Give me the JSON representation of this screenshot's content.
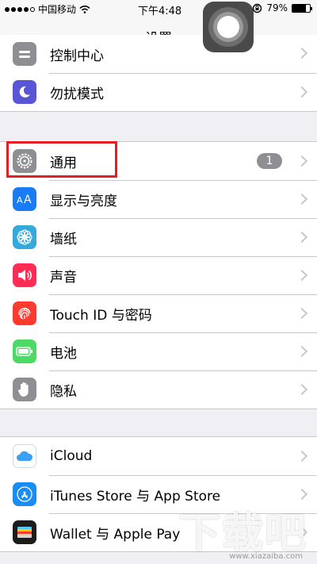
{
  "status_bar": {
    "carrier": "中国移动",
    "time": "下午4:48",
    "battery_text": "79%",
    "battery_level": 0.79
  },
  "nav": {
    "title": "设置"
  },
  "groups": {
    "top": [
      {
        "label": "控制中心",
        "icon": "control-center-icon",
        "color": "#8e8e93"
      },
      {
        "label": "勿扰模式",
        "icon": "moon-icon",
        "color": "#5856d6"
      }
    ],
    "middle": [
      {
        "label": "通用",
        "icon": "gear-icon",
        "color": "#8e8e93",
        "badge": "1"
      },
      {
        "label": "显示与亮度",
        "icon": "display-brightness-icon",
        "color": "#1a7cf5"
      },
      {
        "label": "墙纸",
        "icon": "wallpaper-flower-icon",
        "color": "#34aadc"
      },
      {
        "label": "声音",
        "icon": "speaker-icon",
        "color": "#ff2d55"
      },
      {
        "label": "Touch ID 与密码",
        "icon": "fingerprint-icon",
        "color": "#ff3b30"
      },
      {
        "label": "电池",
        "icon": "battery-icon",
        "color": "#4cd964"
      },
      {
        "label": "隐私",
        "icon": "hand-icon",
        "color": "#8e8e93"
      }
    ],
    "bottom": [
      {
        "label": "iCloud",
        "icon": "cloud-icon",
        "color": "#ffffff"
      },
      {
        "label": "iTunes Store 与 App Store",
        "icon": "app-store-icon",
        "color": "#1a8cf5"
      },
      {
        "label": "Wallet 与 Apple Pay",
        "icon": "wallet-icon",
        "color": "#1c1c1c"
      }
    ]
  },
  "watermark": {
    "text": "下载吧",
    "url": "www.xiazaiba.com"
  },
  "colors": {
    "highlight": "#e31e24",
    "separator": "#c8c7cc",
    "background": "#efeff4"
  }
}
